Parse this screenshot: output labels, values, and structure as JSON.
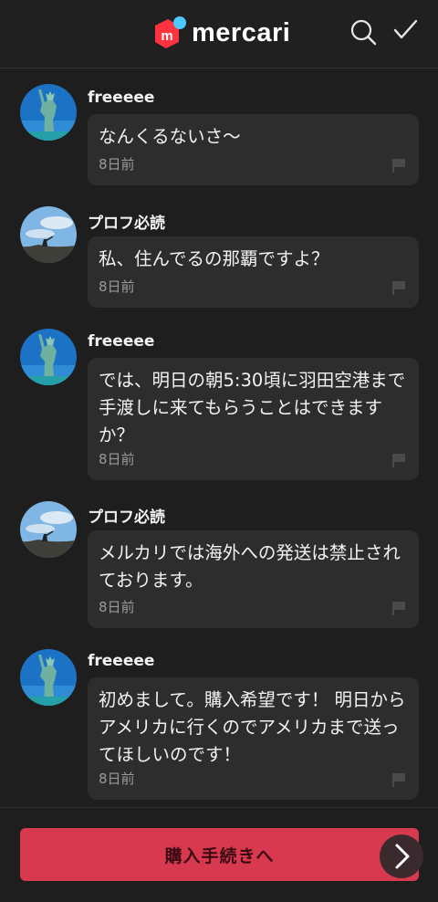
{
  "header": {
    "logo_text": "mercari",
    "search_icon": "search-icon",
    "check_icon": "check-icon"
  },
  "messages": [
    {
      "name": "freeeee",
      "text": "なんくるないさ〜",
      "time": "8日前",
      "avatar": "statue-of-liberty"
    },
    {
      "name": "プロフ必読",
      "text": "私、住んでるの那覇ですよ？",
      "time": "8日前",
      "avatar": "sky-landscape"
    },
    {
      "name": "freeeee",
      "text": "では、明日の朝5:30頃に羽田空港まで手渡しに来てもらうことはできますか？",
      "time": "8日前",
      "avatar": "statue-of-liberty"
    },
    {
      "name": "プロフ必読",
      "text": "メルカリでは海外への発送は禁止されております。",
      "time": "8日前",
      "avatar": "sky-landscape"
    },
    {
      "name": "freeeee",
      "text": "初めまして。購入希望です！ 明日からアメリカに行くのでアメリカまで送ってほしいのです！",
      "time": "8日前",
      "avatar": "statue-of-liberty"
    }
  ],
  "footer": {
    "buy_label": "購入手続きへ",
    "next_icon": "chevron-right-icon"
  },
  "colors": {
    "background": "#1e1e1e",
    "bubble": "#2d2d2d",
    "accent": "#d9394f",
    "brand_red": "#ff333f",
    "brand_blue": "#4dc9ff"
  }
}
